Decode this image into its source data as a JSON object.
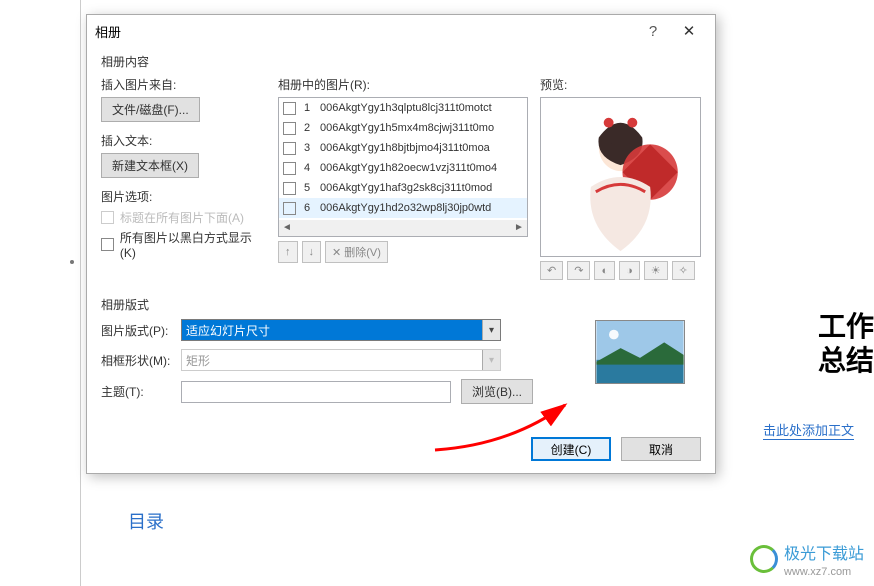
{
  "dialog": {
    "title": "相册",
    "section_content": "相册内容",
    "insert_pic_from": "插入图片来自:",
    "file_disk_btn": "文件/磁盘(F)...",
    "insert_text": "插入文本:",
    "new_textbox_btn": "新建文本框(X)",
    "pic_options": "图片选项:",
    "caption_below": "标题在所有图片下面(A)",
    "all_bw": "所有图片以黑白方式显示(K)",
    "pics_in_album": "相册中的图片(R):",
    "preview": "预览:",
    "remove_btn": "删除(V)",
    "section_format": "相册版式",
    "pic_layout": "图片版式(P):",
    "layout_value": "适应幻灯片尺寸",
    "frame_shape": "相框形状(M):",
    "frame_value": "矩形",
    "theme": "主题(T):",
    "browse_btn": "浏览(B)...",
    "create_btn": "创建(C)",
    "cancel_btn": "取消"
  },
  "pictures": [
    {
      "num": "1",
      "name": "006AkgtYgy1h3qlptu8lcj311t0motct"
    },
    {
      "num": "2",
      "name": "006AkgtYgy1h5mx4m8cjwj311t0mo"
    },
    {
      "num": "3",
      "name": "006AkgtYgy1h8bjtbjmo4j311t0moa"
    },
    {
      "num": "4",
      "name": "006AkgtYgy1h82oecw1vzj311t0mo4"
    },
    {
      "num": "5",
      "name": "006AkgtYgy1haf3g2sk8cj311t0mod"
    },
    {
      "num": "6",
      "name": "006AkgtYgy1hd2o32wp8lj30jp0wtd"
    }
  ],
  "bg": {
    "title1": "工作",
    "title2": "总结",
    "link": "击此处添加正文",
    "toc": "目录"
  },
  "logo": {
    "name": "极光下载站",
    "url": "www.xz7.com"
  }
}
